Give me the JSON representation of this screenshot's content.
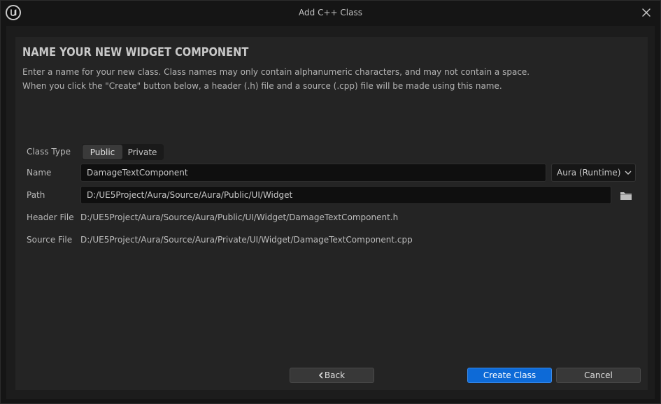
{
  "window": {
    "title": "Add C++ Class"
  },
  "header": {
    "heading": "NAME YOUR NEW WIDGET COMPONENT",
    "description_line1": "Enter a name for your new class. Class names may only contain alphanumeric characters, and may not contain a space.",
    "description_line2": "When you click the \"Create\" button below, a header (.h) file and a source (.cpp) file will be made using this name."
  },
  "form": {
    "class_type": {
      "label": "Class Type",
      "options": [
        "Public",
        "Private"
      ],
      "selected": "Public"
    },
    "name": {
      "label": "Name",
      "value": "DamageTextComponent"
    },
    "module": {
      "value": "Aura (Runtime)"
    },
    "path": {
      "label": "Path",
      "value": "D:/UE5Project/Aura/Source/Aura/Public/UI/Widget"
    },
    "header_file": {
      "label": "Header File",
      "value": "D:/UE5Project/Aura/Source/Aura/Public/UI/Widget/DamageTextComponent.h"
    },
    "source_file": {
      "label": "Source File",
      "value": "D:/UE5Project/Aura/Source/Aura/Private/UI/Widget/DamageTextComponent.cpp"
    }
  },
  "buttons": {
    "back": "Back",
    "create": "Create Class",
    "cancel": "Cancel"
  },
  "icons": {
    "logo": "unreal-logo-icon",
    "close": "close-icon",
    "folder": "folder-icon",
    "chevron_down": "chevron-down-icon",
    "chevron_left": "chevron-left-icon"
  },
  "colors": {
    "accent": "#0d6ad7",
    "background": "#151515",
    "panel": "#242424"
  }
}
